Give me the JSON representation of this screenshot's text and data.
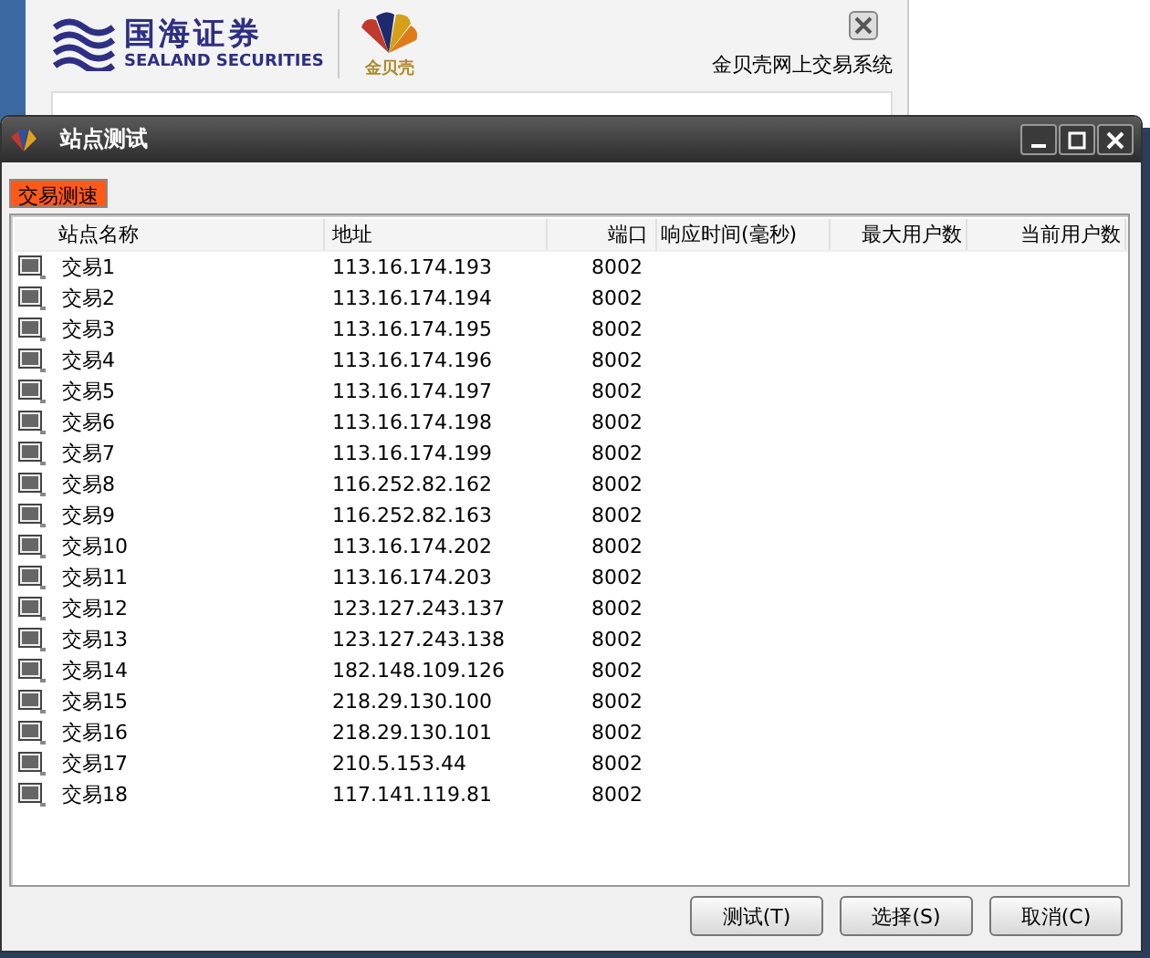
{
  "background_window": {
    "brand_name": "国海证券",
    "brand_english": "SEALAND SECURITIES",
    "product_logo_text": "金贝壳",
    "system_title": "金贝壳网上交易系统"
  },
  "dialog": {
    "title": "站点测试"
  },
  "tabs": [
    {
      "label": "交易测速",
      "selected": true
    }
  ],
  "table": {
    "columns": [
      "站点名称",
      "地址",
      "端口",
      "响应时间(毫秒)",
      "最大用户数",
      "当前用户数"
    ],
    "rows": [
      {
        "name": "交易1",
        "address": "113.16.174.193",
        "port": "8002"
      },
      {
        "name": "交易2",
        "address": "113.16.174.194",
        "port": "8002"
      },
      {
        "name": "交易3",
        "address": "113.16.174.195",
        "port": "8002"
      },
      {
        "name": "交易4",
        "address": "113.16.174.196",
        "port": "8002"
      },
      {
        "name": "交易5",
        "address": "113.16.174.197",
        "port": "8002"
      },
      {
        "name": "交易6",
        "address": "113.16.174.198",
        "port": "8002"
      },
      {
        "name": "交易7",
        "address": "113.16.174.199",
        "port": "8002"
      },
      {
        "name": "交易8",
        "address": "116.252.82.162",
        "port": "8002"
      },
      {
        "name": "交易9",
        "address": "116.252.82.163",
        "port": "8002"
      },
      {
        "name": "交易10",
        "address": "113.16.174.202",
        "port": "8002"
      },
      {
        "name": "交易11",
        "address": "113.16.174.203",
        "port": "8002"
      },
      {
        "name": "交易12",
        "address": "123.127.243.137",
        "port": "8002"
      },
      {
        "name": "交易13",
        "address": "123.127.243.138",
        "port": "8002"
      },
      {
        "name": "交易14",
        "address": "182.148.109.126",
        "port": "8002"
      },
      {
        "name": "交易15",
        "address": "218.29.130.100",
        "port": "8002"
      },
      {
        "name": "交易16",
        "address": "218.29.130.101",
        "port": "8002"
      },
      {
        "name": "交易17",
        "address": "210.5.153.44",
        "port": "8002"
      },
      {
        "name": "交易18",
        "address": "117.141.119.81",
        "port": "8002"
      }
    ]
  },
  "buttons": [
    "测试(T)",
    "选择(S)",
    "取消(C)"
  ]
}
